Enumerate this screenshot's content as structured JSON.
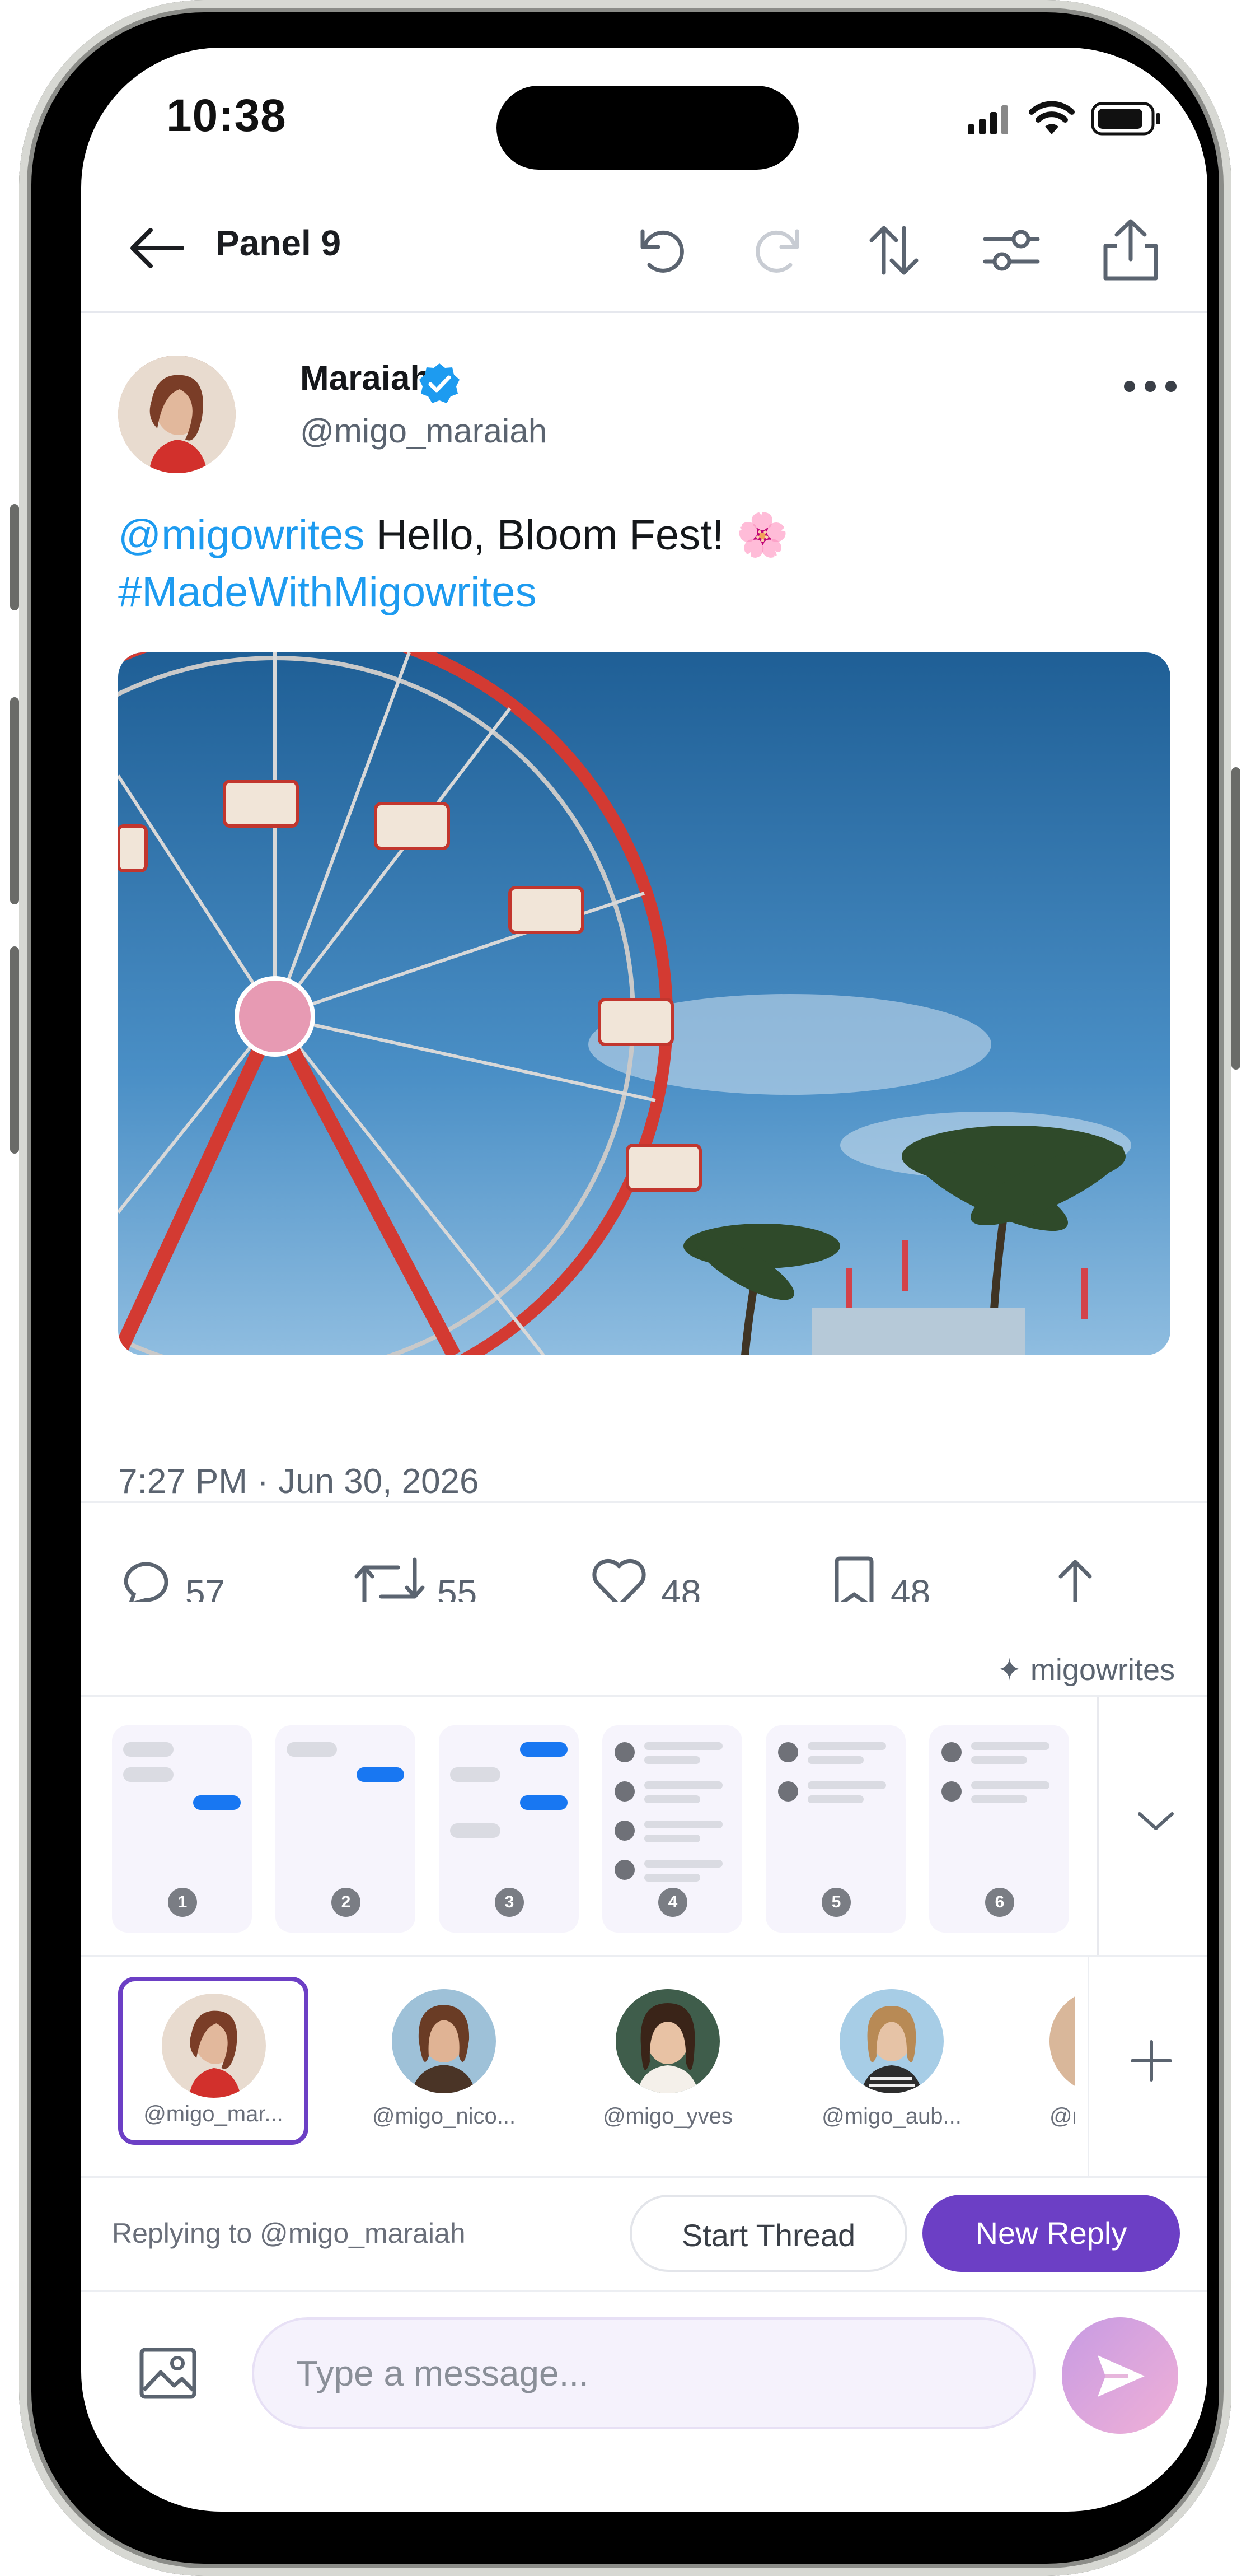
{
  "status_bar": {
    "time": "10:38"
  },
  "header": {
    "title": "Panel 9"
  },
  "post": {
    "author_name": "Maraiah",
    "author_handle": "@migo_maraiah",
    "mention": "@migowrites",
    "text": "Hello, Bloom Fest! 🌸",
    "hashtag": "#MadeWithMigowrites",
    "timestamp": "7:27 PM · Jun 30, 2026",
    "counts": {
      "replies": "57",
      "retweets": "55",
      "likes": "48",
      "bookmarks": "48"
    },
    "watermark": "✦ migowrites"
  },
  "layouts": {
    "items": [
      "1",
      "2",
      "3",
      "4",
      "5",
      "6"
    ]
  },
  "accounts": [
    {
      "handle": "@migo_mar...",
      "selected": true
    },
    {
      "handle": "@migo_nico..."
    },
    {
      "handle": "@migo_yves"
    },
    {
      "handle": "@migo_aub..."
    },
    {
      "handle": "@mi"
    }
  ],
  "reply_bar": {
    "replying_to": "Replying to @migo_maraiah",
    "start_thread": "Start Thread",
    "new_reply": "New Reply"
  },
  "composer": {
    "placeholder": "Type a message..."
  },
  "colors": {
    "accent": "#6c3fc5",
    "link": "#1d9bf0",
    "chat_blue": "#1877f2"
  }
}
